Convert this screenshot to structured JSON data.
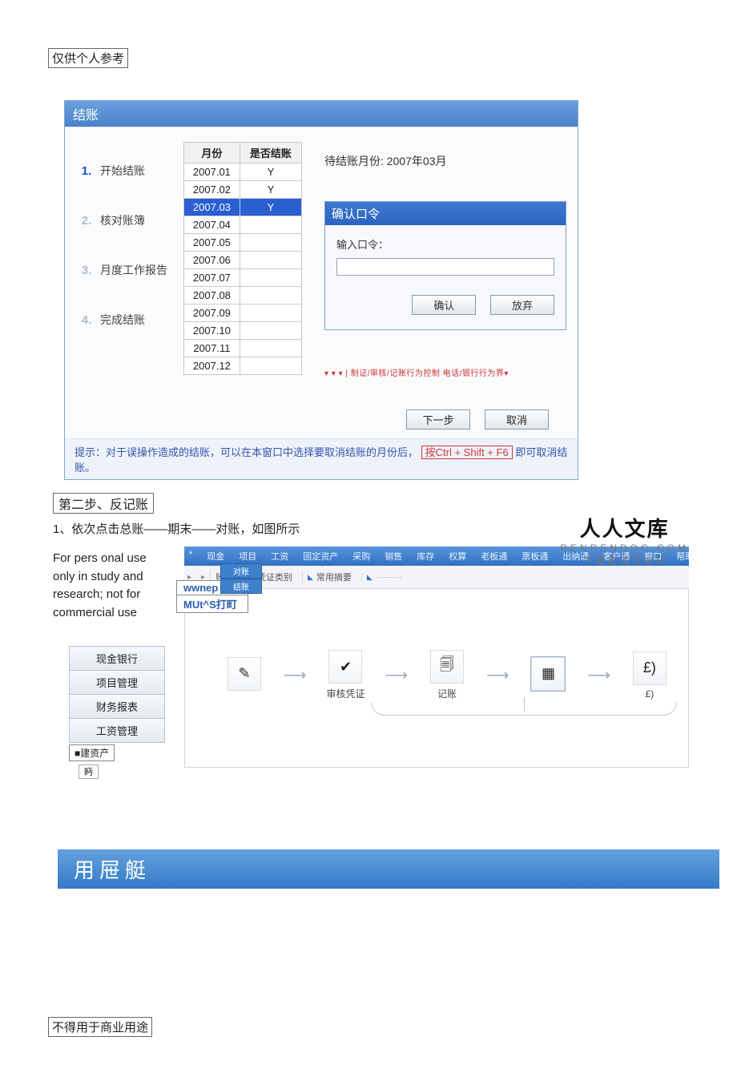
{
  "header_tag": "仅供个人参考",
  "footer_tag": "不得用于商业用途",
  "win1": {
    "title": "结账",
    "steps": [
      {
        "num": "1.",
        "label": "开始结账",
        "active": true
      },
      {
        "num": "2.",
        "label": "核对账簿",
        "active": false
      },
      {
        "num": "3.",
        "label": "月度工作报告",
        "active": false
      },
      {
        "num": "4.",
        "label": "完成结账",
        "active": false
      }
    ],
    "table": {
      "head_month": "月份",
      "head_flag": "是否结账",
      "rows": [
        {
          "m": "2007.01",
          "f": "Y"
        },
        {
          "m": "2007.02",
          "f": "Y"
        },
        {
          "m": "2007.03",
          "f": "Y",
          "selected": true
        },
        {
          "m": "2007.04",
          "f": ""
        },
        {
          "m": "2007.05",
          "f": ""
        },
        {
          "m": "2007.06",
          "f": ""
        },
        {
          "m": "2007.07",
          "f": ""
        },
        {
          "m": "2007.08",
          "f": ""
        },
        {
          "m": "2007.09",
          "f": ""
        },
        {
          "m": "2007.10",
          "f": ""
        },
        {
          "m": "2007.11",
          "f": ""
        },
        {
          "m": "2007.12",
          "f": ""
        }
      ]
    },
    "pending": "待结账月份: 2007年03月",
    "confirm": {
      "title": "确认口令",
      "label": "输入口令：",
      "btn_ok": "确认",
      "btn_cancel": "放弃"
    },
    "bottom_next": "下一步",
    "bottom_cancel": "取消",
    "hint_pre": "提示：对于误操作造成的结账，可以在本窗口中选择要取消结账的月份后，",
    "hint_key": "按Ctrl + Shift + F6",
    "hint_post": "即可取消结账。"
  },
  "step_title": "第二步、反记账",
  "body_line": "1、依次点击总账——期末——对账，如图所示",
  "logo": {
    "big": "人人文库",
    "en": "RENRENDOC.COM",
    "sub": "下 载 高 清 无 水 印"
  },
  "disclaimer_l1": "For pers onal use",
  "disclaimer_l2": "only in study and",
  "disclaimer_l3": "research; not for",
  "disclaimer_l4": "commercial use",
  "tag_box_1": "wwnep",
  "tag_box_2": "MUt^S打町",
  "win2": {
    "menu": [
      "*",
      "现金",
      "项目",
      "工资",
      "固定资产",
      "采购",
      "销售",
      "库存",
      "权算",
      "老板通",
      "票板通",
      "出纳通",
      "客户通",
      "窗口",
      "帮助"
    ],
    "sub_book": "账簿",
    "sub_item1": "凭证类别",
    "sub_item2": "常用摘要",
    "pills": {
      "a": "对账",
      "b": "结账"
    },
    "flow": [
      {
        "label": ""
      },
      {
        "label": "审核凭证"
      },
      {
        "label": "记账"
      },
      {
        "label": ""
      },
      {
        "label": "£)"
      }
    ]
  },
  "nav": [
    "现金银行",
    "项目管理",
    "财务报表",
    "工资管理"
  ],
  "nav_mini": "■建资产",
  "nav_mini2": "眄",
  "footer_bar": "用屉艇"
}
